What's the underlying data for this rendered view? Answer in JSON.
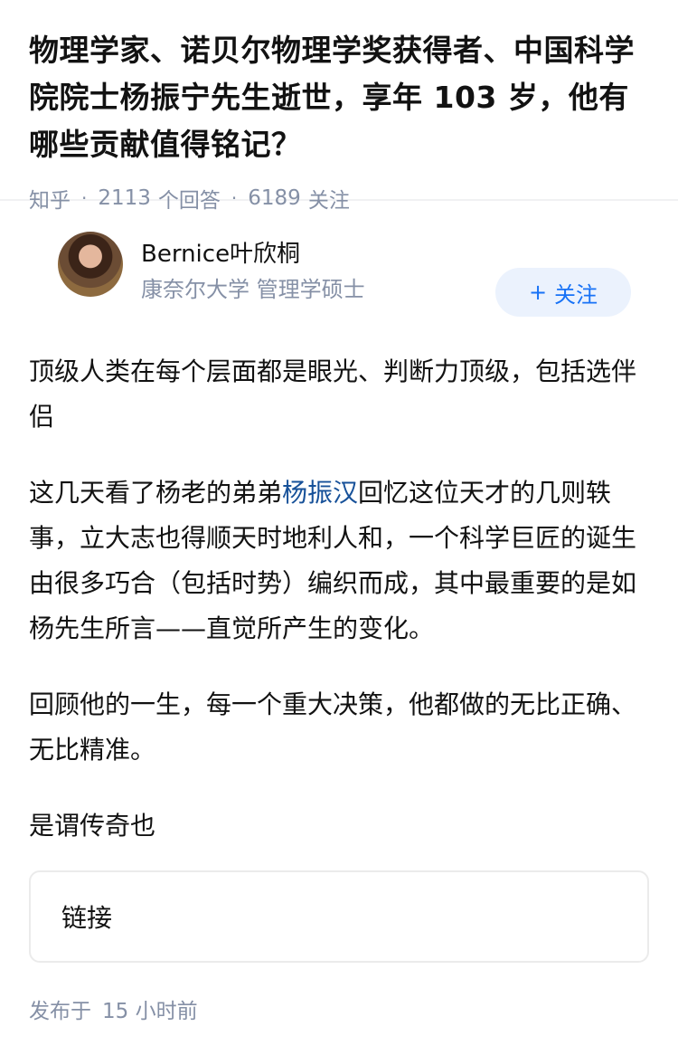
{
  "question": {
    "title": "物理学家、诺贝尔物理学奖获得者、中国科学院院士杨振宁先生逝世，享年 103 岁，他有哪些贡献值得铭记？",
    "source": "知乎",
    "answer_count": "2113",
    "answer_label": "个回答",
    "follower_count": "6189",
    "follower_label": "关注"
  },
  "answer": {
    "author": {
      "name": "Bernice叶欣桐",
      "bio": "康奈尔大学 管理学硕士",
      "follow_label": "关注",
      "follow_plus": "+"
    },
    "paragraphs": {
      "p1": "顶级人类在每个层面都是眼光、判断力顶级，包括选伴侣",
      "p2_before": "这几天看了杨老的弟弟",
      "p2_link": "杨振汉",
      "p2_after": "回忆这位天才的几则轶事，立大志也得顺天时地利人和，一个科学巨匠的诞生由很多巧合（包括时势）编织而成，其中最重要的是如杨先生所言——直觉所产生的变化。",
      "p3": "回顾他的一生，每一个重大决策，他都做的无比正确、无比精准。",
      "p4": "是谓传奇也"
    },
    "link_card_label": "链接",
    "publish_label": "发布于",
    "publish_time": "15 小时前"
  }
}
